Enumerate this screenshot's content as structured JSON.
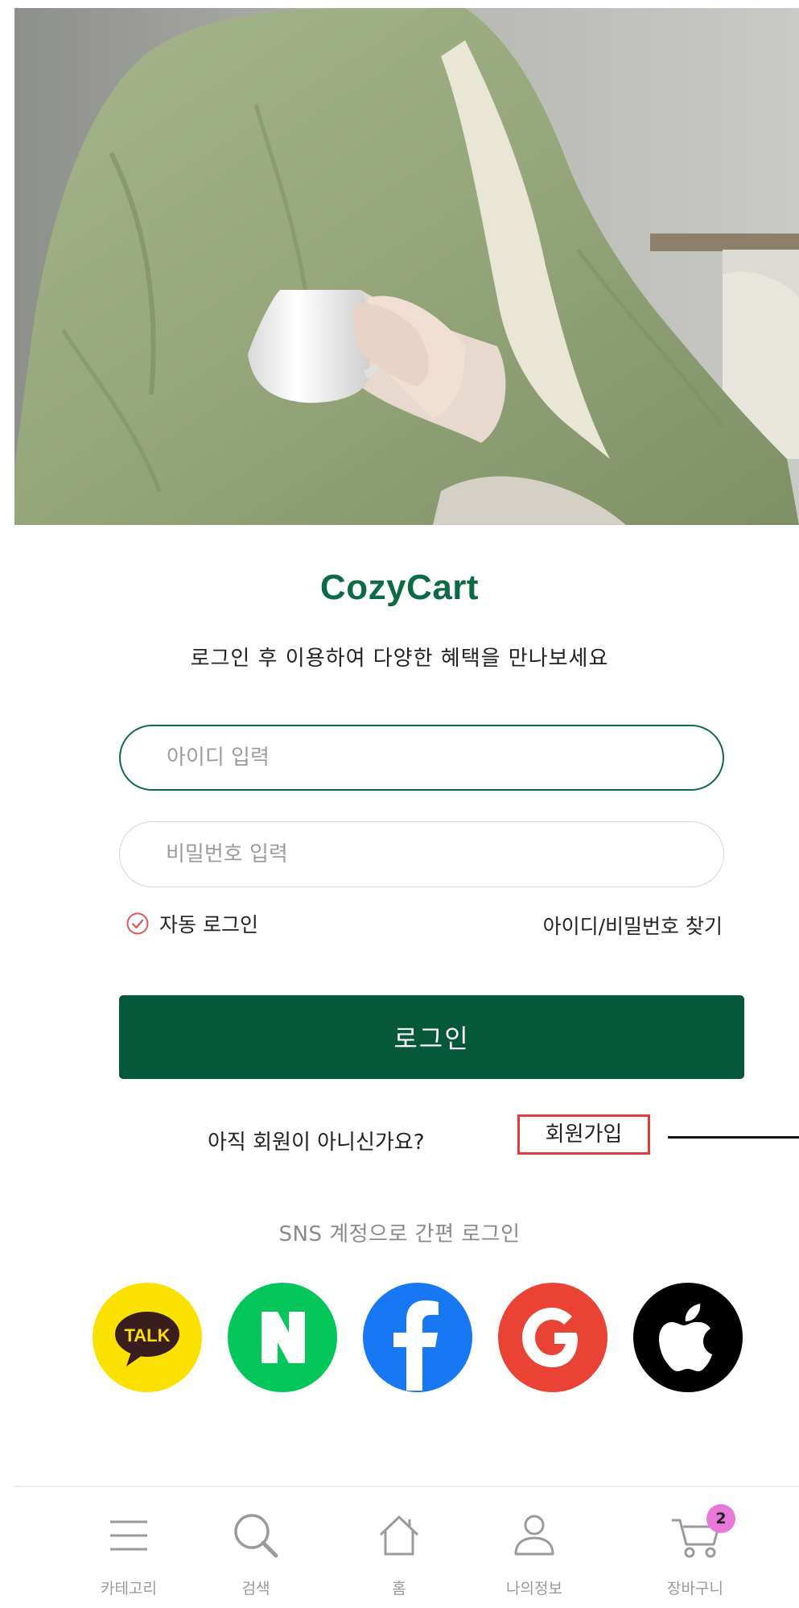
{
  "brand": {
    "name": "CozyCart",
    "tagline": "로그인 후 이용하여 다양한 혜택을 만나보세요",
    "color": "#0d6a47"
  },
  "login_form": {
    "id_placeholder": "아이디 입력",
    "id_value": "",
    "password_placeholder": "비밀번호 입력",
    "password_value": "",
    "auto_login_label": "자동 로그인",
    "auto_login_checked": true,
    "find_account_label": "아이디/비밀번호 찾기",
    "login_button_label": "로그인",
    "button_color": "#05593a"
  },
  "signup": {
    "question": "아직 회원이 아니신가요?",
    "link_label": "회원가입",
    "highlight_color": "#e23b3b"
  },
  "sns": {
    "title": "SNS 계정으로 간편 로그인",
    "providers": [
      {
        "name": "kakao",
        "icon": "kakao-talk-icon",
        "color": "#fae100",
        "glyph": "TALK"
      },
      {
        "name": "naver",
        "icon": "naver-icon",
        "color": "#03c75a",
        "glyph": "N"
      },
      {
        "name": "facebook",
        "icon": "facebook-icon",
        "color": "#1877f2",
        "glyph": "f"
      },
      {
        "name": "google",
        "icon": "google-icon",
        "color": "#ea4335",
        "glyph": "G"
      },
      {
        "name": "apple",
        "icon": "apple-icon",
        "color": "#000000",
        "glyph": ""
      }
    ]
  },
  "tabbar": {
    "items": [
      {
        "label": "카테고리",
        "icon": "menu-icon"
      },
      {
        "label": "검색",
        "icon": "search-icon"
      },
      {
        "label": "홈",
        "icon": "home-icon"
      },
      {
        "label": "나의정보",
        "icon": "user-icon"
      },
      {
        "label": "장바구니",
        "icon": "cart-icon",
        "badge": "2"
      }
    ]
  }
}
